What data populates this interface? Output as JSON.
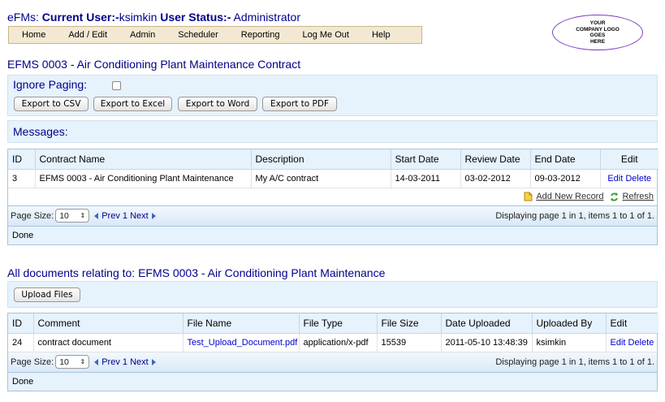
{
  "header": {
    "app": "eFMs:",
    "current_user_label": "Current User:-",
    "current_user": "ksimkin",
    "status_label": "User Status:-",
    "status": "Administrator"
  },
  "nav": [
    "Home",
    "Add / Edit",
    "Admin",
    "Scheduler",
    "Reporting",
    "Log Me Out",
    "Help"
  ],
  "logo": [
    "YOUR",
    "COMPANY LOGO",
    "GOES",
    "HERE"
  ],
  "page_title": "EFMS 0003 - Air Conditioning Plant Maintenance Contract",
  "paging": {
    "label": "Ignore Paging:",
    "checked": false,
    "buttons": [
      "Export to CSV",
      "Export to Excel",
      "Export to Word",
      "Export to PDF"
    ]
  },
  "messages_label": "Messages:",
  "contracts": {
    "columns": [
      "ID",
      "Contract Name",
      "Description",
      "Start Date",
      "Review Date",
      "End Date",
      "Edit"
    ],
    "rows": [
      {
        "id": "3",
        "name": "EFMS 0003 - Air Conditioning Plant Maintenance",
        "description": "My A/C contract",
        "start": "14-03-2011",
        "review": "03-02-2012",
        "end": "09-03-2012",
        "edit": "Edit",
        "delete": "Delete"
      }
    ],
    "add_new": "Add New Record",
    "refresh": "Refresh",
    "page_size_label": "Page Size:",
    "page_size": "10",
    "prev": "Prev",
    "page_num": "1",
    "next": "Next",
    "info": "Displaying page 1 in 1, items 1 to 1 of 1.",
    "status": "Done"
  },
  "documents": {
    "title": "All documents relating to: EFMS 0003 - Air Conditioning Plant Maintenance",
    "upload_button": "Upload Files",
    "columns": [
      "ID",
      "Comment",
      "File Name",
      "File Type",
      "File Size",
      "Date Uploaded",
      "Uploaded By",
      "Edit"
    ],
    "rows": [
      {
        "id": "24",
        "comment": "contract document",
        "file_name": "Test_Upload_Document.pdf",
        "file_type": "application/x-pdf",
        "file_size": "15539",
        "date_uploaded": "2011-05-10 13:48:39",
        "uploaded_by": "ksimkin",
        "edit": "Edit",
        "delete": "Delete"
      }
    ],
    "page_size_label": "Page Size:",
    "page_size": "10",
    "prev": "Prev",
    "page_num": "1",
    "next": "Next",
    "info": "Displaying page 1 in 1, items 1 to 1 of 1.",
    "status": "Done"
  },
  "colors": {
    "title_blue": "#00008b",
    "link_blue": "#0000cc",
    "panel_bg": "#e6f2fc",
    "nav_bg": "#f3e9d2",
    "logo_border": "#7d3cc8"
  }
}
